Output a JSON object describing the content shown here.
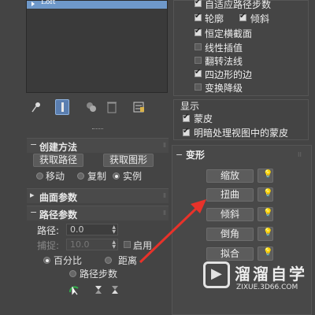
{
  "modifier_stack": {
    "selected_item": "Loft"
  },
  "rollouts": {
    "creation": {
      "title": "创建方法",
      "get_path_button": "获取路径",
      "get_shape_button": "获取图形",
      "options": [
        "移动",
        "复制",
        "实例"
      ],
      "selected": "实例"
    },
    "surface": {
      "title": "曲面参数"
    },
    "path": {
      "title": "路径参数",
      "path_label": "路径:",
      "path_value": "0.0",
      "snap_label": "捕捉:",
      "snap_value": "10.0",
      "enable_label": "启用",
      "percent_label": "百分比",
      "distance_label": "距离",
      "path_steps_label": "路径步数"
    }
  },
  "skin_options": {
    "items": [
      {
        "label": "自适应路径步数",
        "checked": true
      },
      {
        "label": "轮廓",
        "checked": true
      },
      {
        "label": "倾斜",
        "checked": true
      },
      {
        "label": "恒定横截面",
        "checked": true
      },
      {
        "label": "线性插值",
        "checked": false
      },
      {
        "label": "翻转法线",
        "checked": false
      },
      {
        "label": "四边形的边",
        "checked": true
      },
      {
        "label": "变换降级",
        "checked": false
      }
    ]
  },
  "display": {
    "title": "显示",
    "skin_label": "蒙皮",
    "shaded_label": "明暗处理视图中的蒙皮"
  },
  "deformations": {
    "title": "变形",
    "buttons": [
      "缩放",
      "扭曲",
      "倾斜",
      "倒角",
      "拟合"
    ]
  },
  "watermark": {
    "title": "溜溜自学",
    "url": "ZIXUE.3D66.COM"
  },
  "colors": {
    "accent": "#6e98c9",
    "arrow": "#e8322a"
  }
}
